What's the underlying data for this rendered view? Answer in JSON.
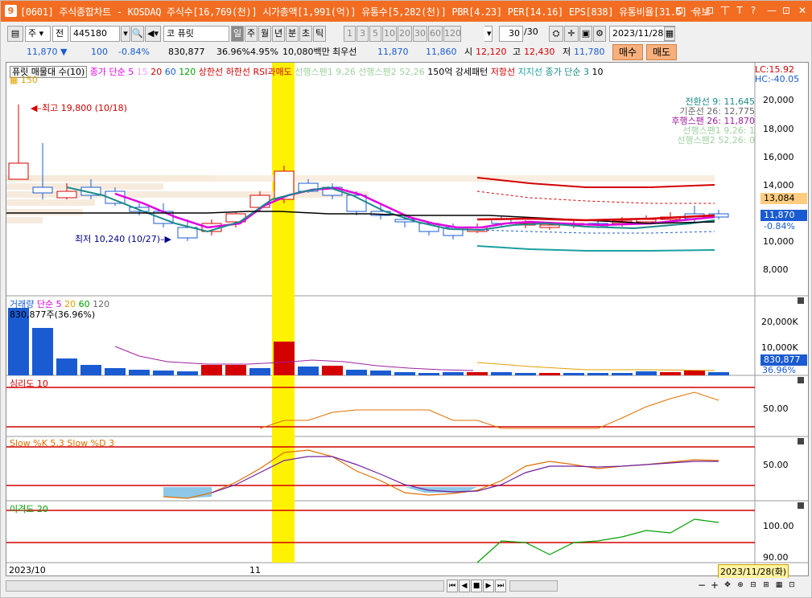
{
  "titlebar": {
    "icon": "9",
    "text": "[0601] 주식종합차트 - KOSDAQ 주식수[16,769(천)] 시가총액[1,991(억)] 유통수[5,282(천)] PBR[4.23] PER[14.16] EPS[838] 유통비율[31.5] 유보",
    "buttons": [
      "⊡",
      "—",
      "⊡",
      "丅",
      "T",
      "?",
      "—",
      "⊡",
      "✕"
    ]
  },
  "toolbar": {
    "market": "주",
    "scope": "전",
    "code": "445180",
    "name_prefix": "코",
    "name": "퓨릿",
    "periods": [
      "일",
      "주",
      "월",
      "년",
      "분",
      "초",
      "틱"
    ],
    "minutes": [
      "1",
      "3",
      "5",
      "10",
      "20",
      "30",
      "60",
      "120"
    ],
    "count": "30",
    "count_total": "/30",
    "date": "2023/11/28"
  },
  "quote": {
    "price": "11,870",
    "change": "100",
    "change_pct": "-0.84%",
    "volume": "830,877",
    "turnover_pct": "36.96%",
    "ratio_pct": "4.95%",
    "amount": "10,080백만",
    "name": "최우선",
    "best1": "11,870",
    "best2": "11,860",
    "open_label": "시",
    "open": "12,120",
    "high_label": "고",
    "high": "12,430",
    "low_label": "저",
    "low": "11,780",
    "buy_label": "매수",
    "sell_label": "매도"
  },
  "price_panel": {
    "legend": {
      "title": "퓨릿 매물대 수(10)",
      "ma_label": "종가 단순",
      "ma_periods": [
        "5",
        "15",
        "20",
        "60",
        "120"
      ],
      "ma150": "150",
      "upper": "상한선",
      "lower": "하한선",
      "rsi": "RSI과매도",
      "span1": "선행스팬1 9,26",
      "span2": "선행스팬2 52,26",
      "pattern": "150억 강세패턴",
      "resist": "저항선",
      "support": "지지선",
      "ma2": "종가 단순 3",
      "ma2b": "10"
    },
    "lc": "LC:15.92",
    "hc": "HC:-40.05",
    "high_note": "최고 19,800 (10/18)",
    "low_note": "최저 10,240 (10/27)",
    "ichimoku": [
      "전환선 9: 11,645",
      "기준선 26: 12,775",
      "후행스팬 26: 11,870",
      "선행스팬1 9,26: 1",
      "선행스팬2 52,26: 0"
    ],
    "y_ticks": [
      "20,000",
      "18,000",
      "16,000",
      "14,000",
      "12,000",
      "10,000",
      "8,000"
    ],
    "price_box": "13,084",
    "current_box": "11,870",
    "current_pct": "-0.84%"
  },
  "volume_panel": {
    "legend_title": "거래량",
    "ma_label": "단순",
    "ma_periods": [
      "5",
      "20",
      "60",
      "120"
    ],
    "note": "830,877주(36.96%)",
    "y_ticks": [
      "20,000K",
      "10,000K"
    ],
    "box": "830,877",
    "box_pct": "36.96%"
  },
  "psy_panel": {
    "legend": "심리도 10",
    "y_ticks": [
      "50.00"
    ]
  },
  "stoch_panel": {
    "legend": "Slow %K 5,3  Slow %D 3",
    "y_ticks": [
      "50.00"
    ]
  },
  "disp_panel": {
    "legend": "이격도 20",
    "y_ticks": [
      "100.00",
      "90.00"
    ]
  },
  "x_axis": {
    "labels": [
      "2023/10",
      "11"
    ],
    "cursor_date": "2023/11/28(화)"
  },
  "colors": {
    "title_bg": "#f26d21",
    "up": "#d40000",
    "down": "#1a5bd1",
    "highlight": "#fff200",
    "ma5": "#e000e0",
    "ma20": "#1b8a8a",
    "ma60": "#000000"
  }
}
